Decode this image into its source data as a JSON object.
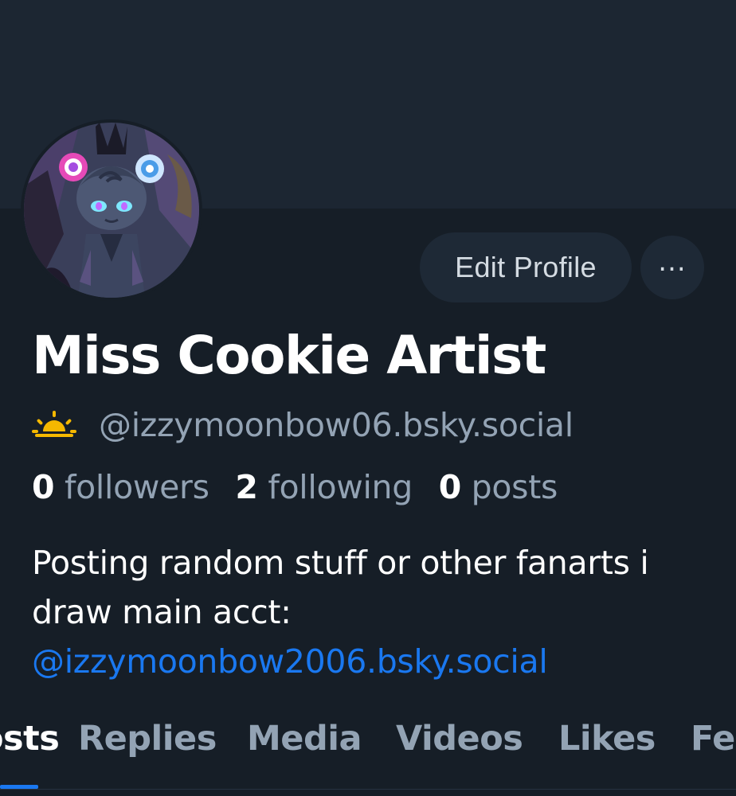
{
  "profile": {
    "display_name": "Miss Cookie Artist",
    "handle": "@izzymoonbow06.bsky.social",
    "status_icon": "sunrise-icon",
    "stats": {
      "followers_count": "0",
      "followers_label": "followers",
      "following_count": "2",
      "following_label": "following",
      "posts_count": "0",
      "posts_label": "posts"
    },
    "bio_text": "Posting random stuff or other fanarts i draw main acct:",
    "bio_link": "@izzymoonbow2006.bsky.social"
  },
  "actions": {
    "edit_label": "Edit Profile",
    "more_label": "..."
  },
  "tabs": [
    {
      "label": "Posts",
      "active": true
    },
    {
      "label": "Replies",
      "active": false
    },
    {
      "label": "Media",
      "active": false
    },
    {
      "label": "Videos",
      "active": false
    },
    {
      "label": "Likes",
      "active": false
    },
    {
      "label": "Feeds",
      "active": false
    }
  ],
  "colors": {
    "background": "#161e27",
    "banner": "#1c2632",
    "accent": "#1a78f0",
    "muted_text": "#93a3b4",
    "button_bg": "#1e2936"
  }
}
